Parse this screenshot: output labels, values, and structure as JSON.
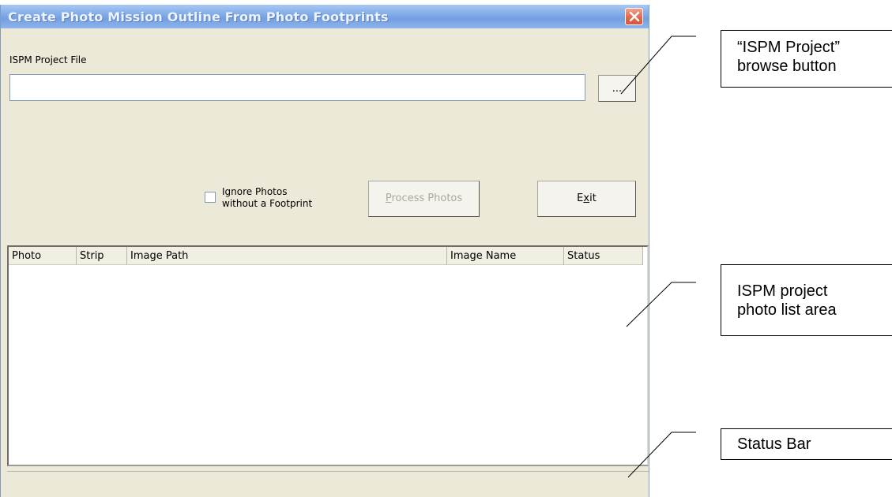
{
  "window": {
    "title": "Create Photo Mission Outline From Photo Footprints",
    "close_label": "Close"
  },
  "project": {
    "label": "ISPM Project File",
    "value": "",
    "browse_label": "..."
  },
  "options": {
    "ignore_line1": "Ignore Photos",
    "ignore_line2": "without  a Footprint",
    "ignore_checked": false
  },
  "buttons": {
    "process_mnemonic": "P",
    "process_rest": "rocess Photos",
    "exit_pre": "E",
    "exit_mnemonic": "x",
    "exit_rest": "it"
  },
  "list": {
    "columns": [
      "Photo",
      "Strip",
      "Image Path",
      "Image Name",
      "Status"
    ],
    "rows": []
  },
  "statusbar": {
    "text": ""
  },
  "annotations": {
    "browse_line1": "“ISPM Project”",
    "browse_line2": "browse button",
    "list_line1": "ISPM project",
    "list_line2": "photo list area",
    "status": "Status Bar"
  },
  "colors": {
    "title_gradient": "#7ea8e6",
    "dialog_bg": "#ece9d8",
    "close_button": "#e06a4e",
    "disabled_text": "#aca899"
  }
}
